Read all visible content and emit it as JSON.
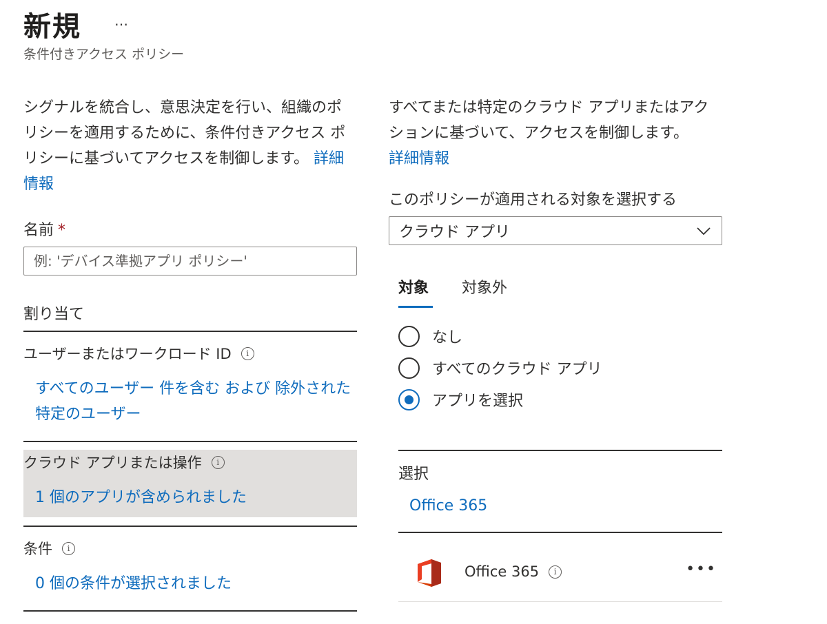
{
  "header": {
    "title": "新規",
    "more": "…",
    "subtitle": "条件付きアクセス ポリシー"
  },
  "left": {
    "description": "シグナルを統合し、意思決定を行い、組織のポリシーを適用するために、条件付きアクセス ポリシーに基づいてアクセスを制御します。",
    "description_link": "詳細情報",
    "name_label": "名前",
    "required_mark": "*",
    "name_placeholder": "例: 'デバイス準拠アプリ ポリシー'",
    "assignments_heading": "割り当て",
    "users_label": "ユーザーまたはワークロード ID",
    "users_link": "すべてのユーザー 件を含む および 除外された特定のユーザー",
    "cloud_apps_label": "クラウド アプリまたは操作",
    "cloud_apps_link": "1 個のアプリが含められました",
    "conditions_label": "条件",
    "conditions_link": "0 個の条件が選択されました"
  },
  "right": {
    "description": "すべてまたは特定のクラウド アプリまたはアクションに基づいて、アクセスを制御します。",
    "description_link": "詳細情報",
    "apply_label": "このポリシーが適用される対象を選択する",
    "select_value": "クラウド アプリ",
    "tabs": [
      "対象",
      "対象外"
    ],
    "radios": [
      "なし",
      "すべてのクラウド アプリ",
      "アプリを選択"
    ],
    "selected_radio": "アプリを選択",
    "select_heading": "選択",
    "select_link": "Office 365",
    "app_name": "Office 365",
    "app_more": "•••"
  },
  "colors": {
    "link": "#0f6cbd",
    "highlight": "#e1dfdd",
    "required": "#a4262c"
  },
  "icons": [
    "info-icon",
    "chevron-down-icon",
    "office-365-logo",
    "more-icon"
  ]
}
